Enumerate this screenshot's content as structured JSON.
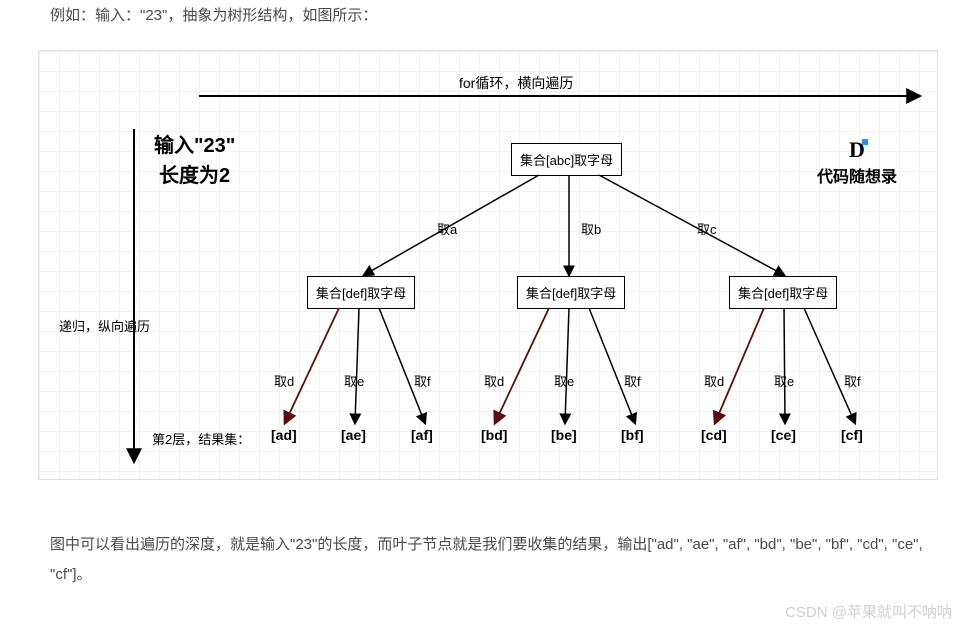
{
  "intro": "例如：输入：\"23\"，抽象为树形结构，如图所示：",
  "diagram": {
    "top_arrow_label": "for循环，横向遍历",
    "input_line1": "输入\"23\"",
    "input_line2": "长度为2",
    "brand": "代码随想录",
    "left_arrow_label": "递归，纵向遍历",
    "root_box": "集合[abc]取字母",
    "root_edges": [
      "取a",
      "取b",
      "取c"
    ],
    "mid_box": "集合[def]取字母",
    "mid_edges": [
      "取d",
      "取e",
      "取f"
    ],
    "result_prefix": "第2层，结果集：",
    "leaves": [
      "[ad]",
      "[ae]",
      "[af]",
      "[bd]",
      "[be]",
      "[bf]",
      "[cd]",
      "[ce]",
      "[cf]"
    ]
  },
  "outro": "图中可以看出遍历的深度，就是输入\"23\"的长度，而叶子节点就是我们要收集的结果，输出[\"ad\", \"ae\", \"af\", \"bd\", \"be\", \"bf\", \"cd\", \"ce\", \"cf\"]。",
  "watermark": "CSDN @苹果就叫不呐呐",
  "chart_data": {
    "type": "table",
    "description": "Backtracking tree for phone letter combinations of input \"23\"",
    "input": "23",
    "depth": 2,
    "mapping": {
      "2": [
        "a",
        "b",
        "c"
      ],
      "3": [
        "d",
        "e",
        "f"
      ]
    },
    "levels": [
      {
        "level": 0,
        "node": "集合[abc]取字母",
        "branches": [
          "a",
          "b",
          "c"
        ]
      },
      {
        "level": 1,
        "node": "集合[def]取字母",
        "branches": [
          "d",
          "e",
          "f"
        ]
      }
    ],
    "results": [
      "ad",
      "ae",
      "af",
      "bd",
      "be",
      "bf",
      "cd",
      "ce",
      "cf"
    ]
  }
}
